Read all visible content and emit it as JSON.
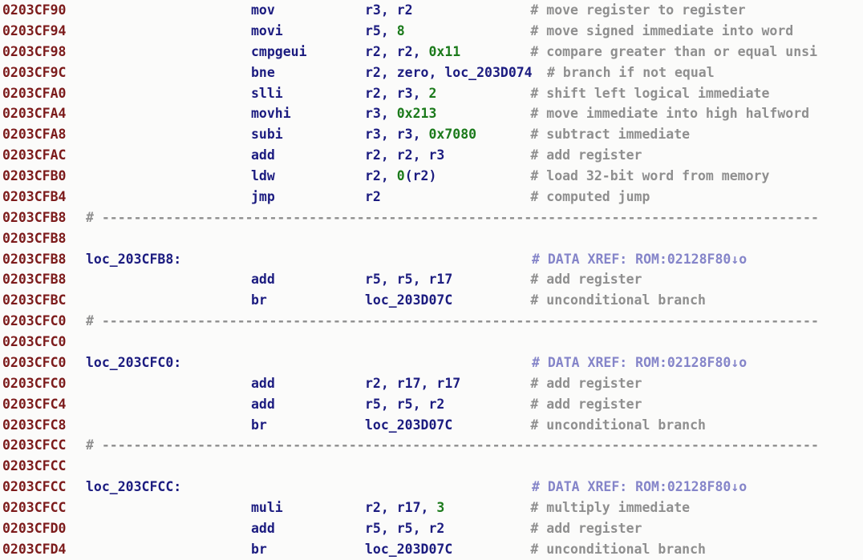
{
  "view": {
    "type": "disassembly-listing",
    "app": "IDA Pro",
    "architecture": "Nios II",
    "background_color": "#fbfbfa"
  },
  "colors": {
    "address": "#7c1b1b",
    "mnemonic": "#1c1c80",
    "operand": "#1c1c80",
    "label": "#1c1c80",
    "number": "#1b7a1b",
    "comment": "#8f8f8f",
    "xref_comment": "#8585c9",
    "separator": "#a2a2a2"
  },
  "separator_text": "# ------------------------------------------------------------------------------------------",
  "lines": [
    {
      "kind": "instruction",
      "address": "0203CF90",
      "mnemonic": "mov",
      "operands": [
        {
          "text": "r3, r2",
          "type": "reg"
        }
      ],
      "comment": "# move register to register"
    },
    {
      "kind": "instruction",
      "address": "0203CF94",
      "mnemonic": "movi",
      "operands": [
        {
          "text": "r5, ",
          "type": "reg"
        },
        {
          "text": "8",
          "type": "num"
        }
      ],
      "comment": "# move signed immediate into word"
    },
    {
      "kind": "instruction",
      "address": "0203CF98",
      "mnemonic": "cmpgeui",
      "operands": [
        {
          "text": "r2, r2, ",
          "type": "reg"
        },
        {
          "text": "0x11",
          "type": "num"
        }
      ],
      "comment": "# compare greater than or equal unsi"
    },
    {
      "kind": "instruction",
      "address": "0203CF9C",
      "mnemonic": "bne",
      "operands": [
        {
          "text": "r2, zero, ",
          "type": "reg"
        },
        {
          "text": "loc_203D074",
          "type": "loc"
        }
      ],
      "comment": "# branch if not equal"
    },
    {
      "kind": "instruction",
      "address": "0203CFA0",
      "mnemonic": "slli",
      "operands": [
        {
          "text": "r2, r3, ",
          "type": "reg"
        },
        {
          "text": "2",
          "type": "num"
        }
      ],
      "comment": "# shift left logical immediate"
    },
    {
      "kind": "instruction",
      "address": "0203CFA4",
      "mnemonic": "movhi",
      "operands": [
        {
          "text": "r3, ",
          "type": "reg"
        },
        {
          "text": "0x213",
          "type": "num"
        }
      ],
      "comment": "# move immediate into high halfword"
    },
    {
      "kind": "instruction",
      "address": "0203CFA8",
      "mnemonic": "subi",
      "operands": [
        {
          "text": "r3, r3, ",
          "type": "reg"
        },
        {
          "text": "0x7080",
          "type": "num"
        }
      ],
      "comment": "# subtract immediate"
    },
    {
      "kind": "instruction",
      "address": "0203CFAC",
      "mnemonic": "add",
      "operands": [
        {
          "text": "r2, r2, r3",
          "type": "reg"
        }
      ],
      "comment": "# add register"
    },
    {
      "kind": "instruction",
      "address": "0203CFB0",
      "mnemonic": "ldw",
      "operands": [
        {
          "text": "r2, ",
          "type": "reg"
        },
        {
          "text": "0",
          "type": "num"
        },
        {
          "text": "(r2)",
          "type": "reg"
        }
      ],
      "comment": "# load 32-bit word from memory"
    },
    {
      "kind": "instruction",
      "address": "0203CFB4",
      "mnemonic": "jmp",
      "operands": [
        {
          "text": "r2",
          "type": "reg"
        }
      ],
      "comment": "# computed jump"
    },
    {
      "kind": "separator",
      "address": "0203CFB8"
    },
    {
      "kind": "blank",
      "address": "0203CFB8"
    },
    {
      "kind": "label",
      "address": "0203CFB8",
      "label": "loc_203CFB8:",
      "xref": "# DATA XREF: ROM:02128F80↓o"
    },
    {
      "kind": "instruction",
      "address": "0203CFB8",
      "mnemonic": "add",
      "operands": [
        {
          "text": "r5, r5, r17",
          "type": "reg"
        }
      ],
      "comment": "# add register"
    },
    {
      "kind": "instruction",
      "address": "0203CFBC",
      "mnemonic": "br",
      "operands": [
        {
          "text": "loc_203D07C",
          "type": "loc"
        }
      ],
      "comment": "# unconditional branch"
    },
    {
      "kind": "separator",
      "address": "0203CFC0"
    },
    {
      "kind": "blank",
      "address": "0203CFC0"
    },
    {
      "kind": "label",
      "address": "0203CFC0",
      "label": "loc_203CFC0:",
      "xref": "# DATA XREF: ROM:02128F80↓o"
    },
    {
      "kind": "instruction",
      "address": "0203CFC0",
      "mnemonic": "add",
      "operands": [
        {
          "text": "r2, r17, r17",
          "type": "reg"
        }
      ],
      "comment": "# add register"
    },
    {
      "kind": "instruction",
      "address": "0203CFC4",
      "mnemonic": "add",
      "operands": [
        {
          "text": "r5, r5, r2",
          "type": "reg"
        }
      ],
      "comment": "# add register"
    },
    {
      "kind": "instruction",
      "address": "0203CFC8",
      "mnemonic": "br",
      "operands": [
        {
          "text": "loc_203D07C",
          "type": "loc"
        }
      ],
      "comment": "# unconditional branch"
    },
    {
      "kind": "separator",
      "address": "0203CFCC"
    },
    {
      "kind": "blank",
      "address": "0203CFCC"
    },
    {
      "kind": "label",
      "address": "0203CFCC",
      "label": "loc_203CFCC:",
      "xref": "# DATA XREF: ROM:02128F80↓o"
    },
    {
      "kind": "instruction",
      "address": "0203CFCC",
      "mnemonic": "muli",
      "operands": [
        {
          "text": "r2, r17, ",
          "type": "reg"
        },
        {
          "text": "3",
          "type": "num"
        }
      ],
      "comment": "# multiply immediate"
    },
    {
      "kind": "instruction",
      "address": "0203CFD0",
      "mnemonic": "add",
      "operands": [
        {
          "text": "r5, r5, r2",
          "type": "reg"
        }
      ],
      "comment": "# add register"
    },
    {
      "kind": "instruction",
      "address": "0203CFD4",
      "mnemonic": "br",
      "operands": [
        {
          "text": "loc_203D07C",
          "type": "loc"
        }
      ],
      "comment": "# unconditional branch"
    }
  ]
}
